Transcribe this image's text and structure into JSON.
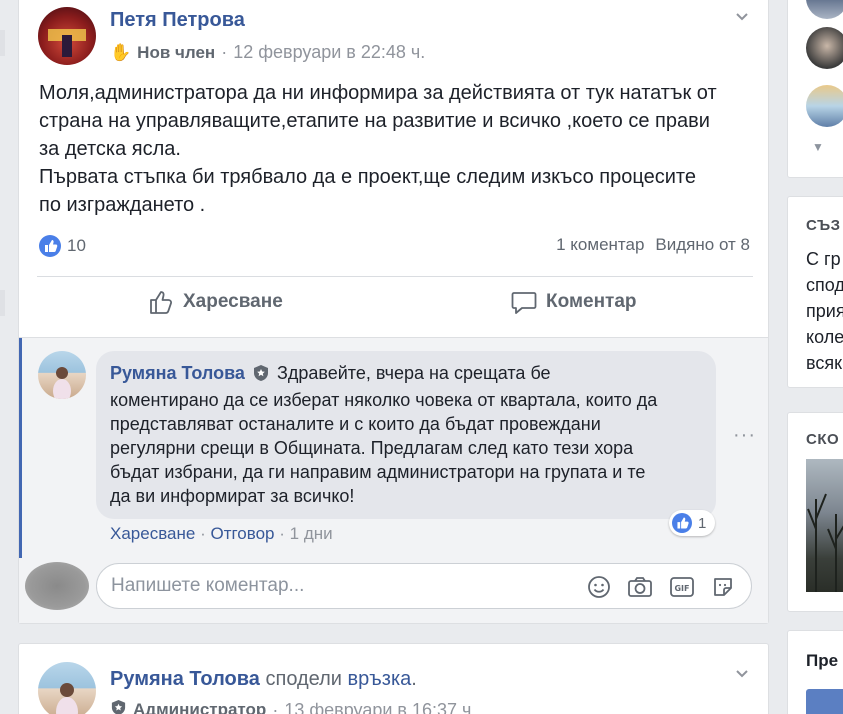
{
  "post1": {
    "author": "Петя Петрова",
    "badge": "Нов член",
    "time": "12 февруари в 22:48 ч.",
    "text_lines": [
      "Моля,администратора да ни информира за действията от тук нататък от",
      "страна на управляващите,етапите на развитие и всичко ,което се прави",
      "за детска ясла.",
      "Първата стъпка би трябвало да е проект,ще следим изкъсо процесите",
      "по изграждането ."
    ],
    "likes": "10",
    "comments_count": "1 коментар",
    "seen_by": "Видяно от 8",
    "like_label": "Харесване",
    "comment_label": "Коментар"
  },
  "comment": {
    "author": "Румяна Толова",
    "lines": [
      "Здравейте, вчера на срещата бе",
      "коментирано да се изберат няколко човека от квартала, които да",
      "представляват останалите и с които да бъдат провеждани",
      "регулярни срещи в Общината. Предлагам след като тези хора",
      "бъдат избрани, да ги направим администратори на групата и те",
      "да ви информират за всичко!"
    ],
    "like_action": "Харесване",
    "reply_action": "Отговор",
    "age": "1 дни",
    "reactions": "1"
  },
  "composer": {
    "placeholder": "Напишете коментар..."
  },
  "post2": {
    "author": "Румяна Толова",
    "action": "сподели",
    "link_word": "връзка",
    "badge": "Администратор",
    "time": "13 февруари в 16:37 ч."
  },
  "right": {
    "card2_heading": "СЪЗ",
    "card2_lines": [
      "С гр",
      "спод",
      "прия",
      "коле",
      "всяк"
    ],
    "card3_heading": "СКО",
    "card4_heading": "Пре"
  },
  "colors": {
    "link": "#385898",
    "like_blue": "#4a7fe8",
    "admin_bar": "#4267b2"
  }
}
